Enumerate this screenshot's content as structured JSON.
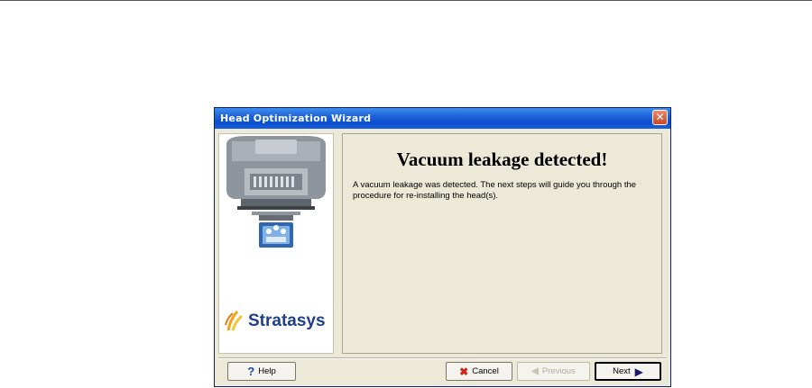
{
  "window": {
    "title": "Head Optimization Wizard",
    "close_glyph": "✕"
  },
  "side": {
    "brand": "Stratasys"
  },
  "main": {
    "heading": "Vacuum leakage detected!",
    "message": "A vacuum leakage was detected. The next steps will guide you through the procedure for re-installing the head(s)."
  },
  "buttons": {
    "help": "Help",
    "cancel": "Cancel",
    "previous": "Previous",
    "next": "Next"
  },
  "icons": {
    "help": "question-icon",
    "cancel": "cross-icon",
    "previous": "arrow-left-icon",
    "next": "arrow-right-icon"
  }
}
